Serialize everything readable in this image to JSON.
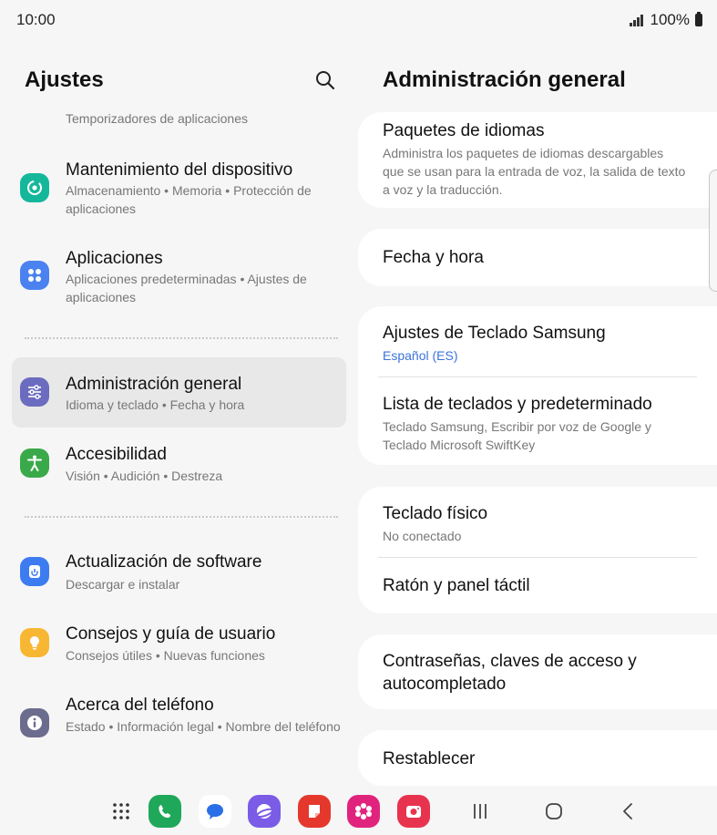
{
  "status_bar": {
    "time": "10:00",
    "battery": "100%"
  },
  "left_panel": {
    "title": "Ajustes",
    "partial_subtitle": "Temporizadores de aplicaciones",
    "items": [
      {
        "title": "Mantenimiento del dispositivo",
        "subtitle": "Almacenamiento  •  Memoria  •  Protección de aplicaciones",
        "icon": "device-care-icon",
        "color": "#15b79b"
      },
      {
        "title": "Aplicaciones",
        "subtitle": "Aplicaciones predeterminadas  •  Ajustes de aplicaciones",
        "icon": "apps-icon",
        "color": "#4b82f0"
      },
      {
        "title": "Administración general",
        "subtitle": "Idioma y teclado  •  Fecha y hora",
        "icon": "sliders-icon",
        "color": "#6b6bbf",
        "selected": true
      },
      {
        "title": "Accesibilidad",
        "subtitle": "Visión  •  Audición  •  Destreza",
        "icon": "accessibility-icon",
        "color": "#3aa94a"
      },
      {
        "title": "Actualización de software",
        "subtitle": "Descargar e instalar",
        "icon": "software-update-icon",
        "color": "#3d7cf0"
      },
      {
        "title": "Consejos y guía de usuario",
        "subtitle": "Consejos útiles  •  Nuevas funciones",
        "icon": "tips-bulb-icon",
        "color": "#f7b733"
      },
      {
        "title": "Acerca del teléfono",
        "subtitle": "Estado  •  Información legal  •  Nombre del teléfono",
        "icon": "info-icon",
        "color": "#6c6c8f"
      }
    ]
  },
  "right_panel": {
    "title": "Administración general",
    "cards": [
      {
        "rows": [
          {
            "title": "Paquetes de idiomas",
            "subtitle": "Administra los paquetes de idiomas descargables que se usan para la entrada de voz, la salida de texto a voz y la traducción."
          }
        ]
      },
      {
        "rows": [
          {
            "title": "Fecha y hora"
          }
        ]
      },
      {
        "rows": [
          {
            "title": "Ajustes de Teclado Samsung",
            "subtitle": "Español (ES)"
          },
          {
            "title": "Lista de teclados y predeterminado",
            "subtitle": "Teclado Samsung, Escribir por voz de Google y Teclado Microsoft SwiftKey"
          }
        ]
      },
      {
        "rows": [
          {
            "title": "Teclado físico",
            "subtitle": "No conectado"
          },
          {
            "title": "Ratón y panel táctil"
          }
        ]
      },
      {
        "rows": [
          {
            "title": "Contraseñas, claves de acceso y autocompletado"
          }
        ]
      },
      {
        "rows": [
          {
            "title": "Restablecer"
          }
        ]
      }
    ]
  },
  "navbar": {
    "dock": [
      "app-drawer-icon",
      "phone-app-icon",
      "messages-app-icon",
      "internet-app-icon",
      "notes-app-icon",
      "gallery-app-icon",
      "camera-app-icon"
    ],
    "buttons": [
      "recents-button",
      "home-button",
      "back-button"
    ]
  },
  "colors": {
    "accent_blue": "#3b73d9",
    "selected_bg": "#e8e8e8"
  }
}
